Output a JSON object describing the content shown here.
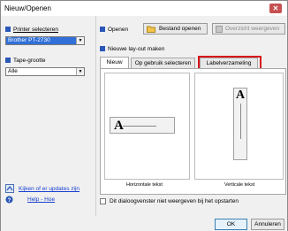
{
  "window": {
    "title": "Nieuw/Openen",
    "close_glyph": "✕"
  },
  "left": {
    "printer_label": "Printer selecteren",
    "printer_value": "Brother PT-2730",
    "tape_label": "Tape-grootte",
    "tape_value": "Alle",
    "updates_link": "Kijken of er updates zijn",
    "help_link": "Help - Hoe"
  },
  "right": {
    "open_label": "Openen",
    "file_open_button": "Bestand openen",
    "history_button": "Overzicht weergeven",
    "new_layout_label": "Nieuwe lay-out maken",
    "tabs": [
      {
        "label": "Nieuw",
        "active": true
      },
      {
        "label": "Op gebruik selecteren",
        "active": false
      },
      {
        "label": "Labelverzameling",
        "active": false,
        "highlighted": true
      }
    ],
    "templates": [
      {
        "caption": "Horizontale tekst",
        "glyph": "A"
      },
      {
        "caption": "Verticale tekst",
        "glyph": "A"
      }
    ],
    "dont_show_label": "Dit dialoogvenster niet weergeven bij het opstarten"
  },
  "footer": {
    "ok": "OK",
    "cancel": "Annuleren"
  },
  "colors": {
    "accent": "#2a57b8",
    "highlight": "#d8141c",
    "close": "#c75050"
  }
}
